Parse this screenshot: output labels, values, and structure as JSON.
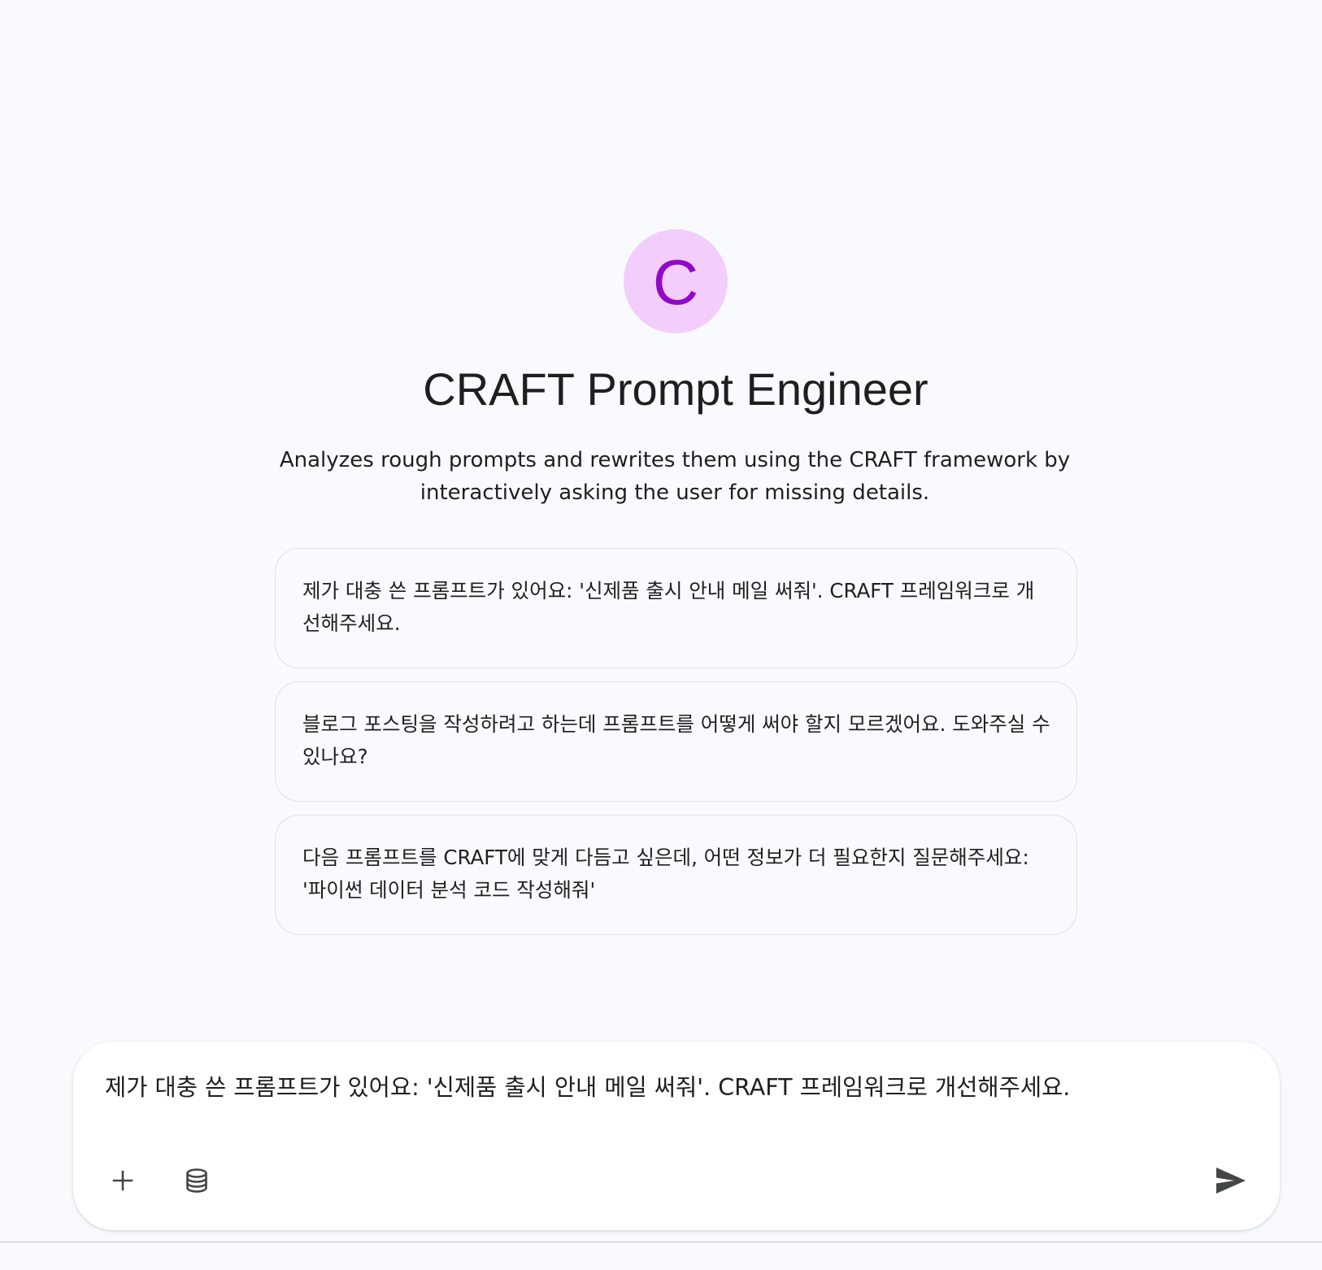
{
  "agent": {
    "avatar_letter": "C",
    "name": "CRAFT Prompt Engineer",
    "description": "Analyzes rough prompts and rewrites them using the CRAFT framework by interactively asking the user for missing details."
  },
  "suggestions": [
    {
      "text": "제가 대충 쓴 프롬프트가 있어요: '신제품 출시 안내 메일 써줘'. CRAFT 프레임워크로 개선해주세요."
    },
    {
      "text": "블로그 포스팅을 작성하려고 하는데 프롬프트를 어떻게 써야 할지 모르겠어요. 도와주실 수 있나요?"
    },
    {
      "text": "다음 프롬프트를 CRAFT에 맞게 다듬고 싶은데, 어떤 정보가 더 필요한지 질문해주세요: '파이썬 데이터 분석 코드 작성해줘'"
    }
  ],
  "composer": {
    "value": "제가 대충 쓴 프롬프트가 있어요: '신제품 출시 안내 메일 써줘'. CRAFT 프레임워크로 개선해주세요.",
    "add_icon": "plus-icon",
    "db_icon": "database-icon",
    "send_icon": "send-icon"
  },
  "colors": {
    "background": "#f8fafd",
    "avatar_bg": "#f3cdfb",
    "avatar_fg": "#9208c9",
    "card_border": "#dde3ea",
    "icon": "#444746"
  }
}
